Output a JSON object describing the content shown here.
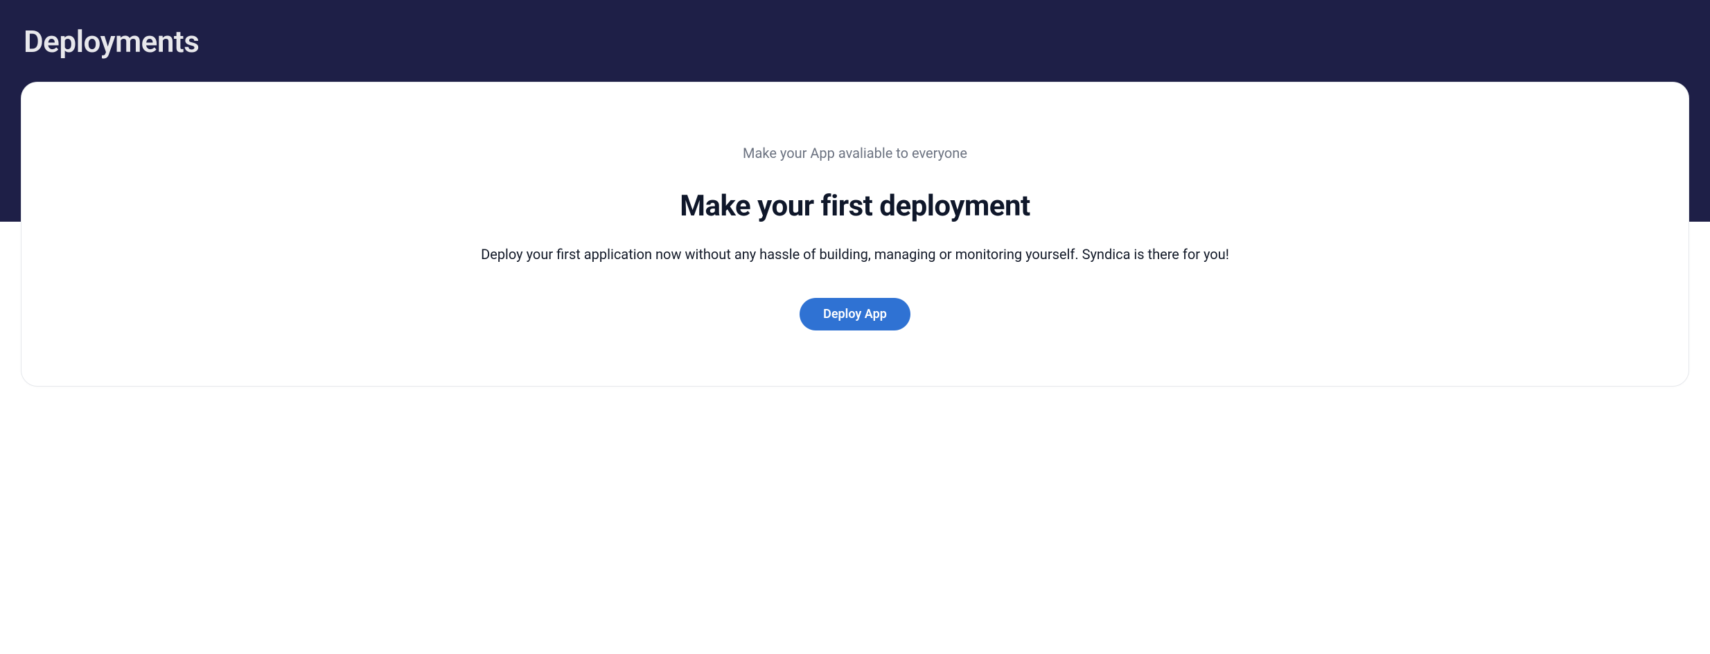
{
  "page": {
    "title": "Deployments"
  },
  "card": {
    "subtitle": "Make your App avaliable to everyone",
    "heading": "Make your first deployment",
    "description": "Deploy your first application now without any hassle of building, managing or monitoring yourself. Syndica is there for you!",
    "button_label": "Deploy App"
  }
}
